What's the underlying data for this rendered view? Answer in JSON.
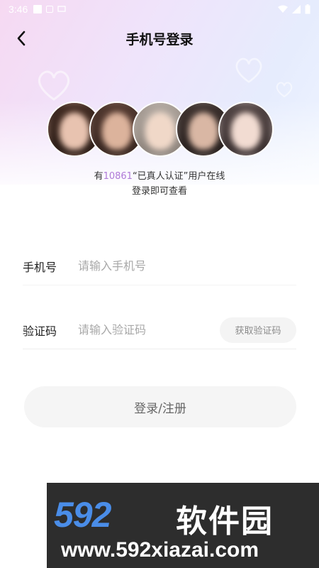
{
  "status_bar": {
    "time": "3:46"
  },
  "nav": {
    "title": "手机号登录",
    "back_icon": "chevron-left-icon"
  },
  "online": {
    "prefix": "有",
    "count": "10861",
    "suffix": "“已真人认证”用户在线",
    "line2": "登录即可查看"
  },
  "form": {
    "phone_label": "手机号",
    "phone_placeholder": "请输入手机号",
    "phone_value": "",
    "code_label": "验证码",
    "code_placeholder": "请输入验证码",
    "code_value": "",
    "get_code_label": "获取验证码"
  },
  "login_button": {
    "label": "登录/注册"
  },
  "watermark": {
    "logo_number": "592",
    "logo_text": "软件园",
    "url": "www.592xiazai.com"
  },
  "colors": {
    "accent": "#b07ad8",
    "watermark_blue": "#4a8de8",
    "watermark_bg": "#2d2d2d"
  }
}
